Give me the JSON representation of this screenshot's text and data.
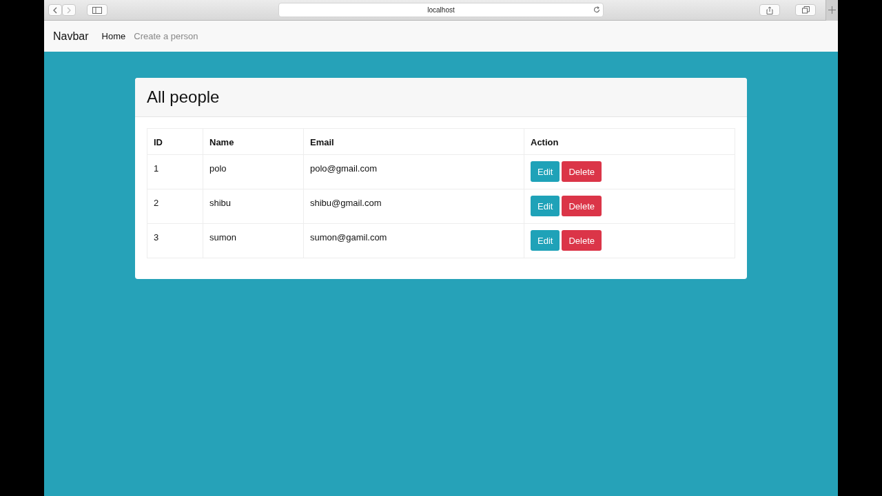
{
  "browser": {
    "address": "localhost"
  },
  "navbar": {
    "brand": "Navbar",
    "links": [
      {
        "label": "Home",
        "selected": true
      },
      {
        "label": "Create a person",
        "selected": false
      }
    ]
  },
  "card": {
    "title": "All people"
  },
  "table": {
    "columns": [
      "ID",
      "Name",
      "Email",
      "Action"
    ],
    "rows": [
      {
        "id": "1",
        "name": "polo",
        "email": "polo@gmail.com",
        "actions": [
          "Edit",
          "Delete"
        ]
      },
      {
        "id": "2",
        "name": "shibu",
        "email": "shibu@gmail.com",
        "actions": [
          "Edit",
          "Delete"
        ]
      },
      {
        "id": "3",
        "name": "sumon",
        "email": "sumon@gamil.com",
        "actions": [
          "Edit",
          "Delete"
        ]
      }
    ]
  }
}
